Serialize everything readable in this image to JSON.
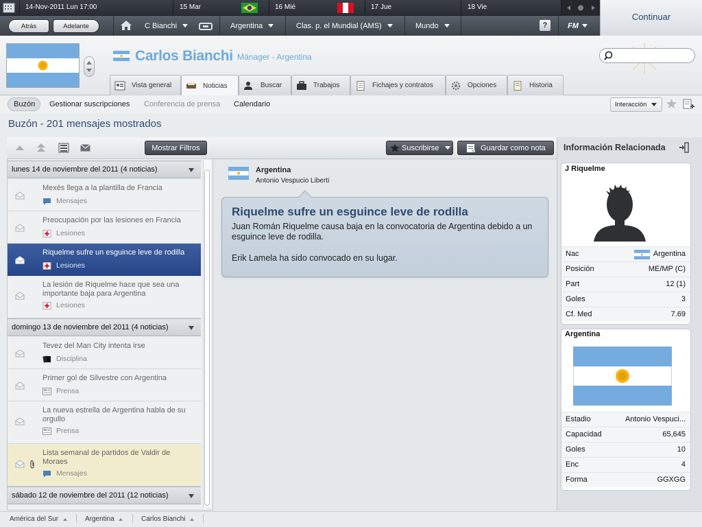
{
  "calendar": {
    "current": "14-Nov-2011 Lun 17:00",
    "days": [
      "15 Mar",
      "16 Mié",
      "17 Jue",
      "18 Vie"
    ],
    "continue_label": "Continuar"
  },
  "nav": {
    "back": "Atrás",
    "forward": "Adelante",
    "manager_menu": "C Bianchi",
    "team_menu": "Argentina",
    "ranking_menu": "Clas. p. el Mundial (AMS)",
    "world_menu": "Mundo",
    "help": "?",
    "fm_menu": "FM"
  },
  "header": {
    "name": "Carlos Bianchi",
    "role": "Mánager - Argentina",
    "search_placeholder": ""
  },
  "tabs": [
    {
      "label": "Vista general",
      "icon": "profile-card-icon"
    },
    {
      "label": "Noticias",
      "icon": "newspaper-icon"
    },
    {
      "label": "Buscar",
      "icon": "person-search-icon"
    },
    {
      "label": "Trabajos",
      "icon": "briefcase-icon"
    },
    {
      "label": "Fichajes y contratos",
      "icon": "document-icon"
    },
    {
      "label": "Opciones",
      "icon": "gear-icon"
    },
    {
      "label": "Historia",
      "icon": "notes-icon"
    }
  ],
  "subnav": {
    "inbox": "Buzón",
    "subscriptions": "Gestionar suscripciones",
    "press": "Conferencia de prensa",
    "calendar": "Calendario",
    "interaction": "Interacción"
  },
  "page_heading": "Buzón - 201 mensajes mostrados",
  "list": {
    "show_filters": "Mostrar Filtros",
    "groups": [
      {
        "label": "lunes 14 de noviembre del 2011 (4 noticias)"
      },
      {
        "label": "domingo 13 de noviembre del 2011 (4 noticias)"
      },
      {
        "label": "sábado 12 de noviembre del 2011 (12 noticias)"
      }
    ],
    "messages": [
      {
        "title": "Mexès llega a la plantilla de Francia",
        "category": "Mensajes",
        "cat_icon": "speech-bubble-icon"
      },
      {
        "title": "Preocupación por las lesiones en Francia",
        "category": "Lesiones",
        "cat_icon": "medical-cross-icon"
      },
      {
        "title": "Riquelme sufre un esguince leve de rodilla",
        "category": "Lesiones",
        "cat_icon": "medical-cross-icon"
      },
      {
        "title": "La lesión de Riquelme hace que sea una importante baja para Argentina",
        "category": "Lesiones",
        "cat_icon": "medical-cross-icon"
      },
      {
        "title": "Tevez del Man City intenta irse",
        "category": "Disciplina",
        "cat_icon": "cards-icon"
      },
      {
        "title": "Primer gol de Silvestre con Argentina",
        "category": "Prensa",
        "cat_icon": "newspaper-icon"
      },
      {
        "title": "La nueva estrella de Argentina habla de su orgullo",
        "category": "Prensa",
        "cat_icon": "newspaper-icon"
      },
      {
        "title": "Lista semanal de partidos de Valdir de Moraes",
        "category": "Mensajes",
        "cat_icon": "speech-bubble-icon"
      }
    ]
  },
  "message_view": {
    "subscribe": "Suscribirse",
    "save_note": "Guardar como nota",
    "from": "Argentina",
    "from_sub": "Antonio Vespucio Liberti",
    "title": "Riquelme sufre un esguince leve de rodilla",
    "body1": "Juan Román Riquelme causa baja en la convocatoria de Argentina debido a un esguince leve de rodilla.",
    "body2": "Erik Lamela ha sido convocado en su lugar."
  },
  "related": {
    "title": "Información Relacionada",
    "player": {
      "name": "J Riquelme",
      "rows": [
        {
          "label": "Nac",
          "value": "Argentina"
        },
        {
          "label": "Posición",
          "value": "ME/MP (C)"
        },
        {
          "label": "Part",
          "value": "12 (1)"
        },
        {
          "label": "Goles",
          "value": "3"
        },
        {
          "label": "Cf. Med",
          "value": "7.69"
        }
      ]
    },
    "team": {
      "name": "Argentina",
      "rows": [
        {
          "label": "Estadio",
          "value": "Antonio Vespuci..."
        },
        {
          "label": "Capacidad",
          "value": "65,645"
        },
        {
          "label": "Goles",
          "value": "10"
        },
        {
          "label": "Enc",
          "value": "4"
        },
        {
          "label": "Forma",
          "value": "GGXGG"
        }
      ]
    }
  },
  "breadcrumbs": [
    "América del Sur",
    "Argentina",
    "Carlos Bianchi"
  ],
  "colors": {
    "accent": "#6fa9d8",
    "heading": "#2e4a6e",
    "selected_row": "#2f4f92",
    "argentina_blue": "#74acdf"
  }
}
